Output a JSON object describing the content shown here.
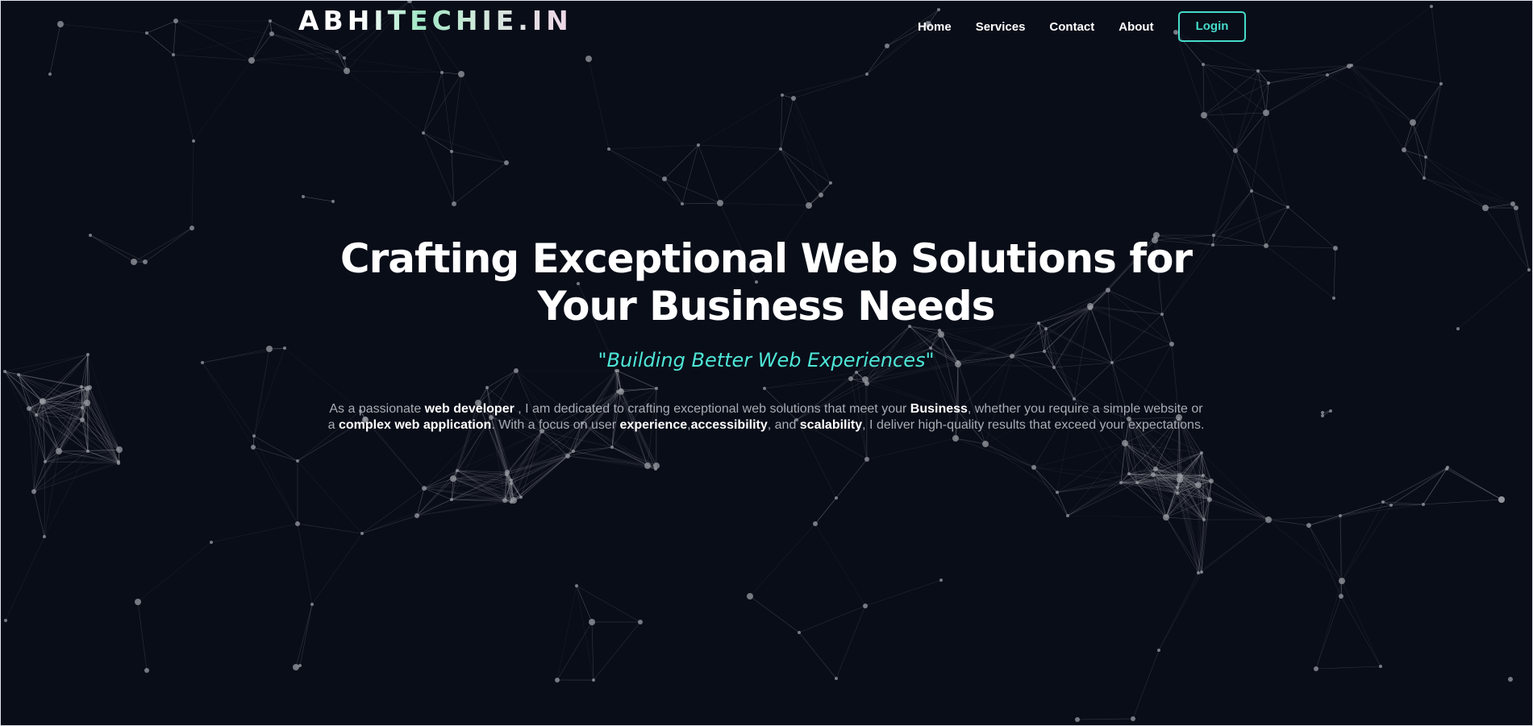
{
  "brand": {
    "logo_text": "ABHITECHIE.IN"
  },
  "nav": {
    "links": [
      "Home",
      "Services",
      "Contact",
      "About"
    ],
    "login_label": "Login",
    "accent_color": "#46dccb"
  },
  "hero": {
    "title": "Crafting Exceptional Web Solutions for Your Business Needs",
    "tagline": "\"Building Better Web Experiences\"",
    "description": {
      "t1": "As a passionate ",
      "b1": "web developer",
      "t2": " , I am dedicated to crafting exceptional web solutions that meet your ",
      "b2": "Business",
      "t3": ", whether you require a simple website or a ",
      "b3": "complex web application",
      "t4": ". With a focus on user ",
      "b4": "experience",
      "t5": ",",
      "b5": "accessibility",
      "t6": ", and ",
      "b6": "scalability",
      "t7": ", I deliver high-quality results that exceed your expectations."
    }
  },
  "theme": {
    "background": "#090d18",
    "tagline_color": "#4ee6d7",
    "particle_color": "#9a9ca3"
  }
}
